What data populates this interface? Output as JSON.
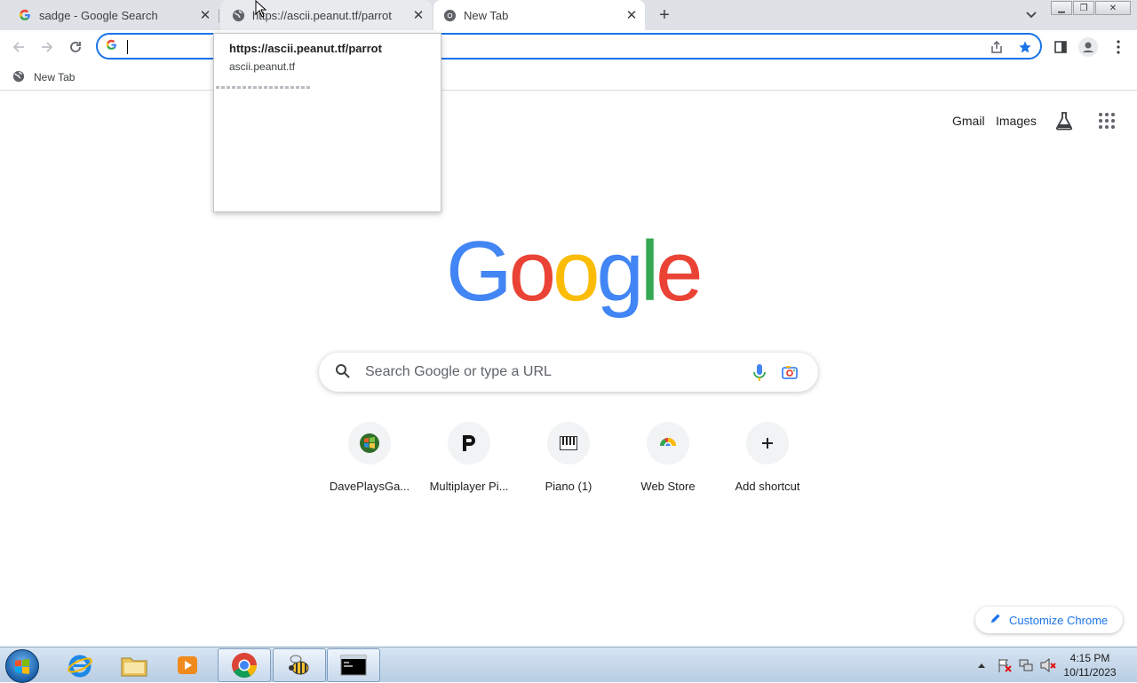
{
  "browser": {
    "tabs": [
      {
        "title": "sadge - Google Search",
        "favicon": "google-g-icon"
      },
      {
        "title": "https://ascii.peanut.tf/parrot",
        "favicon": "globe-icon"
      },
      {
        "title": "New Tab",
        "favicon": "chrome-icon",
        "active": true
      }
    ],
    "new_tab_symbol": "+",
    "omnibox": {
      "value": "",
      "icon": "google-g-icon"
    },
    "bookmarks": [
      {
        "label": "New Tab",
        "icon": "globe-icon"
      }
    ]
  },
  "hovercard": {
    "title": "https://ascii.peanut.tf/parrot",
    "domain": "ascii.peanut.tf"
  },
  "page": {
    "top_links": {
      "gmail": "Gmail",
      "images": "Images"
    },
    "logo_letters": [
      {
        "ch": "G",
        "color": "#4285f4"
      },
      {
        "ch": "o",
        "color": "#ea4335"
      },
      {
        "ch": "o",
        "color": "#fbbc05"
      },
      {
        "ch": "g",
        "color": "#4285f4"
      },
      {
        "ch": "l",
        "color": "#34a853"
      },
      {
        "ch": "e",
        "color": "#ea4335"
      }
    ],
    "search": {
      "placeholder": "Search Google or type a URL"
    },
    "shortcuts": [
      {
        "label": "DavePlaysGa...",
        "icon": "windows-orb-icon"
      },
      {
        "label": "Multiplayer Pi...",
        "icon": "p-logo-icon"
      },
      {
        "label": "Piano (1)",
        "icon": "piano-icon"
      },
      {
        "label": "Web Store",
        "icon": "web-store-icon"
      },
      {
        "label": "Add shortcut",
        "icon": "plus-icon"
      }
    ],
    "customize_label": "Customize Chrome"
  },
  "taskbar": {
    "clock_time": "4:15 PM",
    "clock_date": "10/11/2023"
  },
  "colors": {
    "accent": "#1a73e8",
    "tabstrip_bg": "#dee1e6"
  }
}
